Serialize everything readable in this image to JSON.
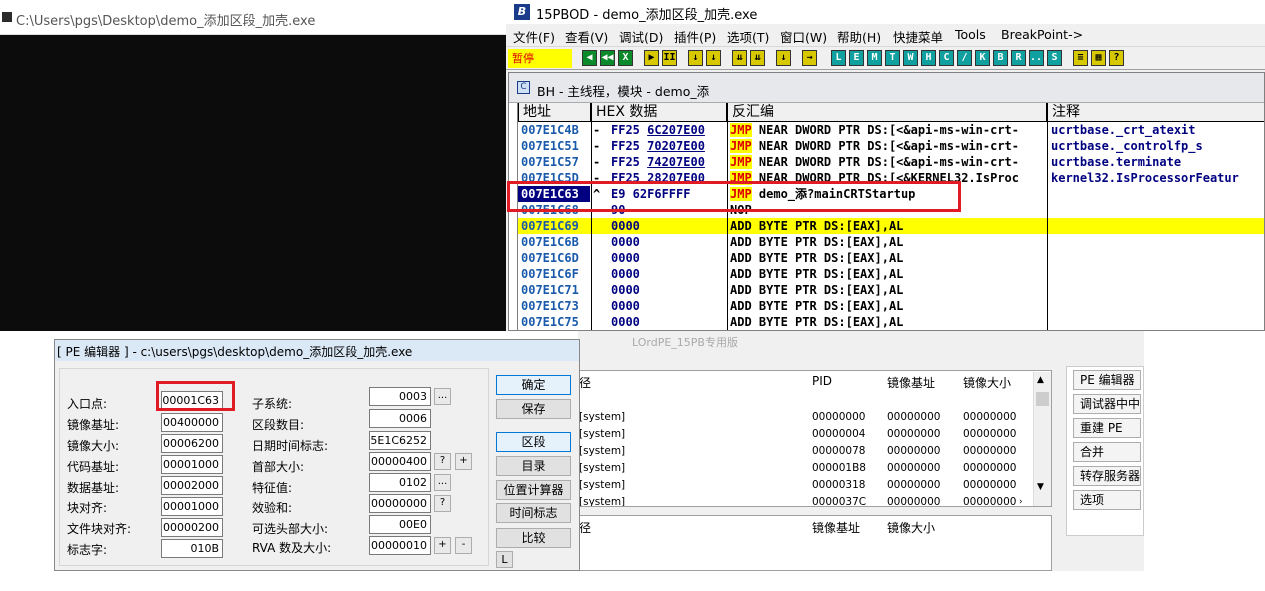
{
  "console": {
    "title": "C:\\Users\\pgs\\Desktop\\demo_添加区段_加壳.exe"
  },
  "debugger": {
    "title": "15PBOD  - demo_添加区段_加壳.exe",
    "logo": "B",
    "menu": [
      "文件(F)",
      "查看(V)",
      "调试(D)",
      "插件(P)",
      "选项(T)",
      "窗口(W)",
      "帮助(H)",
      "快捷菜单",
      "Tools",
      "BreakPoint->"
    ],
    "status": "暂停",
    "toolbar_buttons": [
      "◀",
      "◀◀",
      "X",
      "▶",
      "II",
      "↓",
      "↓",
      "⇊",
      "⇊",
      "↓",
      "→",
      "L",
      "E",
      "M",
      "T",
      "W",
      "H",
      "C",
      "/",
      "K",
      "B",
      "R",
      "...",
      "S",
      "≡",
      "▦",
      "?"
    ],
    "cpu_title": "BH - 主线程，模块 - demo_添",
    "columns": {
      "addr": "地址",
      "hex": "HEX 数据",
      "dis": "反汇编",
      "cmt": "注释"
    },
    "rows": [
      {
        "addr": "007E1C4B",
        "mark": "-",
        "hex": "FF25 ",
        "hexu": "6C207E00",
        "op": "JMP",
        "rest": " NEAR DWORD PTR DS:[<&api-ms-win-crt-",
        "cmt": "ucrtbase._crt_atexit"
      },
      {
        "addr": "007E1C51",
        "mark": "-",
        "hex": "FF25 ",
        "hexu": "70207E00",
        "op": "JMP",
        "rest": " NEAR DWORD PTR DS:[<&api-ms-win-crt-",
        "cmt": "ucrtbase._controlfp_s"
      },
      {
        "addr": "007E1C57",
        "mark": "-",
        "hex": "FF25 ",
        "hexu": "74207E00",
        "op": "JMP",
        "rest": " NEAR DWORD PTR DS:[<&api-ms-win-crt-",
        "cmt": "ucrtbase.terminate"
      },
      {
        "addr": "007E1C5D",
        "mark": "-",
        "hex": "FF25 ",
        "hexu": "28207E00",
        "op": "JMP",
        "rest": " NEAR DWORD PTR DS:[<&KERNEL32.IsProc",
        "cmt": "kernel32.IsProcessorFeatur"
      },
      {
        "addr": "007E1C63",
        "mark": "^",
        "hex": "E9 62F6FFFF",
        "hexu": "",
        "op": "JMP",
        "rest": " demo_添?mainCRTStartup",
        "cmt": ""
      },
      {
        "addr": "007E1C68",
        "mark": "",
        "hex": "90",
        "hexu": "",
        "op": "NOP",
        "rest": "",
        "cmt": ""
      },
      {
        "addr": "007E1C69",
        "mark": "",
        "hex": "0000",
        "hexu": "",
        "op": "",
        "rest": "ADD BYTE PTR DS:[EAX],AL",
        "cmt": ""
      },
      {
        "addr": "007E1C6B",
        "mark": "",
        "hex": "0000",
        "hexu": "",
        "op": "",
        "rest": "ADD BYTE PTR DS:[EAX],AL",
        "cmt": ""
      },
      {
        "addr": "007E1C6D",
        "mark": "",
        "hex": "0000",
        "hexu": "",
        "op": "",
        "rest": "ADD BYTE PTR DS:[EAX],AL",
        "cmt": ""
      },
      {
        "addr": "007E1C6F",
        "mark": "",
        "hex": "0000",
        "hexu": "",
        "op": "",
        "rest": "ADD BYTE PTR DS:[EAX],AL",
        "cmt": ""
      },
      {
        "addr": "007E1C71",
        "mark": "",
        "hex": "0000",
        "hexu": "",
        "op": "",
        "rest": "ADD BYTE PTR DS:[EAX],AL",
        "cmt": ""
      },
      {
        "addr": "007E1C73",
        "mark": "",
        "hex": "0000",
        "hexu": "",
        "op": "",
        "rest": "ADD BYTE PTR DS:[EAX],AL",
        "cmt": ""
      },
      {
        "addr": "007E1C75",
        "mark": "",
        "hex": "0000",
        "hexu": "",
        "op": "",
        "rest": "ADD BYTE PTR DS:[EAX],AL",
        "cmt": ""
      }
    ]
  },
  "proc": {
    "ghost_title": "LOrdPE_15PB专用版",
    "headers": [
      "径",
      "PID",
      "镜像基址",
      "镜像大小"
    ],
    "rows": [
      [
        "[system]",
        "00000000",
        "00000000",
        "00000000"
      ],
      [
        "[system]",
        "00000004",
        "00000000",
        "00000000"
      ],
      [
        "[system]",
        "00000078",
        "00000000",
        "00000000"
      ],
      [
        "[system]",
        "000001B8",
        "00000000",
        "00000000"
      ],
      [
        "[system]",
        "00000318",
        "00000000",
        "00000000"
      ],
      [
        "[system]",
        "0000037C",
        "00000000",
        "00000000"
      ]
    ],
    "module_headers": [
      "径",
      "镜像基址",
      "镜像大小"
    ],
    "buttons": [
      "PE 编辑器",
      "调试器中中断",
      "重建 PE",
      "合并",
      "转存服务器",
      "选项"
    ]
  },
  "pe": {
    "title": "[ PE 编辑器 ] - c:\\users\\pgs\\desktop\\demo_添加区段_加壳.exe",
    "left": [
      {
        "label": "入口点:",
        "value": "00001C63"
      },
      {
        "label": "镜像基址:",
        "value": "00400000"
      },
      {
        "label": "镜像大小:",
        "value": "00006200"
      },
      {
        "label": "代码基址:",
        "value": "00001000"
      },
      {
        "label": "数据基址:",
        "value": "00002000"
      },
      {
        "label": "块对齐:",
        "value": "00001000"
      },
      {
        "label": "文件块对齐:",
        "value": "00000200"
      },
      {
        "label": "标志字:",
        "value": "010B"
      }
    ],
    "right": [
      {
        "label": "子系统:",
        "value": "0003"
      },
      {
        "label": "区段数目:",
        "value": "0006"
      },
      {
        "label": "日期时间标志:",
        "value": "5E1C6252"
      },
      {
        "label": "首部大小:",
        "value": "00000400"
      },
      {
        "label": "特征值:",
        "value": "0102"
      },
      {
        "label": "效验和:",
        "value": "00000000"
      },
      {
        "label": "可选头部大小:",
        "value": "00E0"
      },
      {
        "label": "RVA 数及大小:",
        "value": "00000010"
      }
    ],
    "buttons": [
      "确定",
      "保存",
      "区段",
      "目录",
      "位置计算器",
      "时间标志",
      "比较",
      "L"
    ],
    "small": {
      "dots": "...",
      "q": "?",
      "plus": "+",
      "minus": "-"
    }
  }
}
